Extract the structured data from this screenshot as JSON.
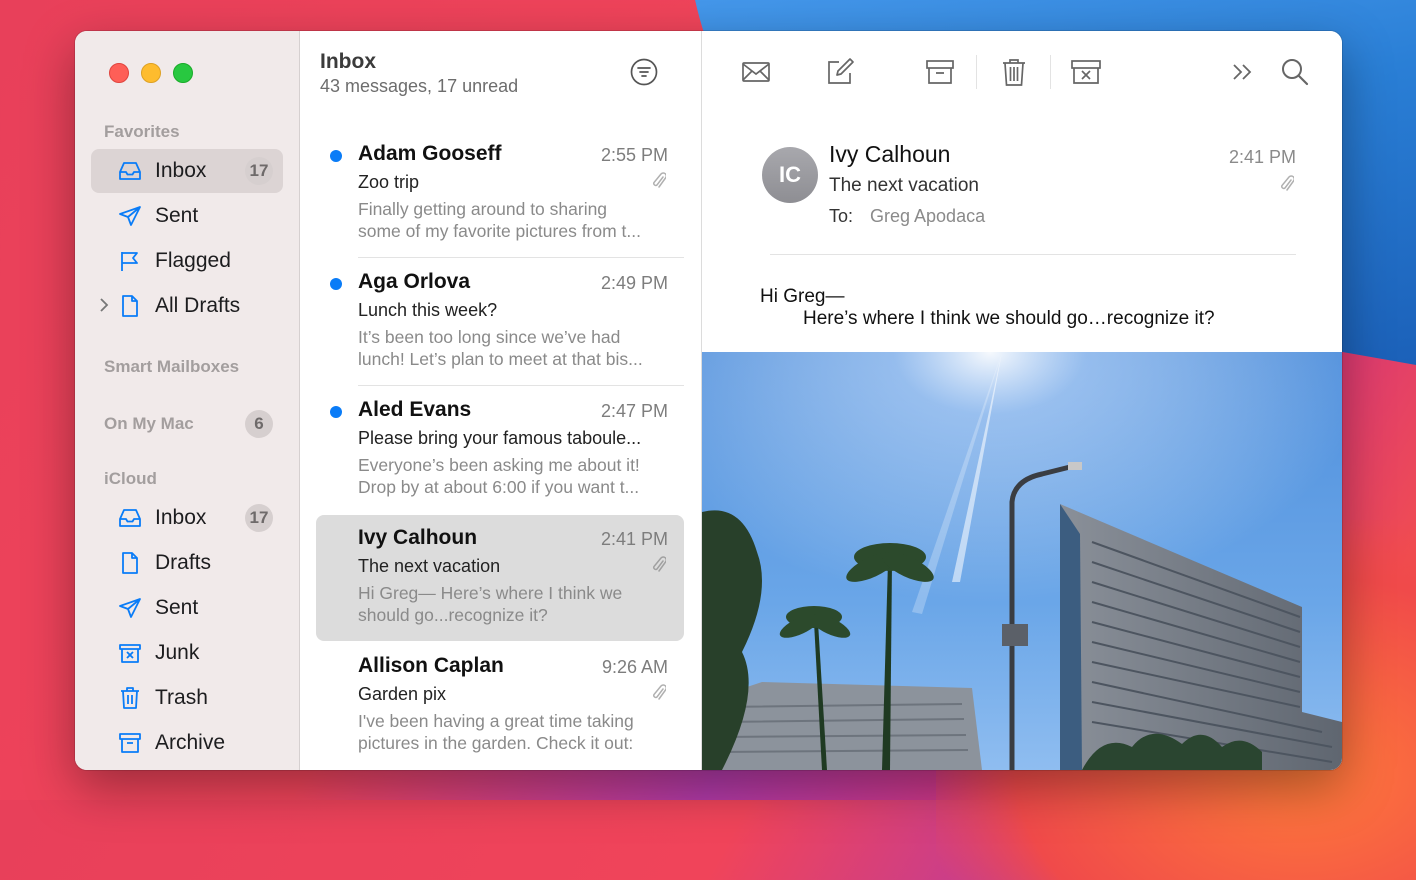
{
  "sidebar": {
    "favorites_header": "Favorites",
    "favorites": [
      {
        "label": "Inbox",
        "badge": "17",
        "icon": "inbox-icon",
        "selected": true
      },
      {
        "label": "Sent",
        "icon": "sent-icon"
      },
      {
        "label": "Flagged",
        "icon": "flag-icon"
      },
      {
        "label": "All Drafts",
        "icon": "drafts-icon",
        "expandable": true
      }
    ],
    "smart_mailboxes_header": "Smart Mailboxes",
    "on_my_mac_header": "On My Mac",
    "on_my_mac_badge": "6",
    "icloud_header": "iCloud",
    "icloud": [
      {
        "label": "Inbox",
        "badge": "17",
        "icon": "inbox-icon"
      },
      {
        "label": "Drafts",
        "icon": "drafts-icon"
      },
      {
        "label": "Sent",
        "icon": "sent-icon"
      },
      {
        "label": "Junk",
        "icon": "junk-icon"
      },
      {
        "label": "Trash",
        "icon": "trash-icon"
      },
      {
        "label": "Archive",
        "icon": "archive-icon"
      }
    ]
  },
  "list": {
    "title": "Inbox",
    "subtitle": "43 messages, 17 unread",
    "messages": [
      {
        "from": "Adam Gooseff",
        "time": "2:55 PM",
        "subject": "Zoo trip",
        "preview1": "Finally getting around to sharing",
        "preview2": "some of my favorite pictures from t...",
        "unread": true,
        "attachment": true
      },
      {
        "from": "Aga Orlova",
        "time": "2:49 PM",
        "subject": "Lunch this week?",
        "preview1": "It’s been too long since we’ve had",
        "preview2": "lunch! Let’s plan to meet at that bis...",
        "unread": true,
        "attachment": false
      },
      {
        "from": "Aled Evans",
        "time": "2:47 PM",
        "subject": "Please bring your famous taboule...",
        "preview1": "Everyone’s been asking me about it!",
        "preview2": "Drop by at about 6:00 if you want t...",
        "unread": true,
        "attachment": false
      },
      {
        "from": "Ivy Calhoun",
        "time": "2:41 PM",
        "subject": "The next vacation",
        "preview1": "Hi Greg— Here’s where I think we",
        "preview2": "should go...recognize it?",
        "unread": false,
        "attachment": true,
        "selected": true
      },
      {
        "from": "Allison Caplan",
        "time": "9:26 AM",
        "subject": "Garden pix",
        "preview1": "I've been having a great time taking",
        "preview2": "pictures in the garden. Check it out:",
        "unread": false,
        "attachment": true
      }
    ]
  },
  "reader": {
    "avatar_initials": "IC",
    "from": "Ivy Calhoun",
    "subject": "The next vacation",
    "to_label": "To:",
    "to": "Greg Apodaca",
    "time": "2:41 PM",
    "greeting": "Hi Greg—",
    "body": "Here’s where I think we should go…recognize it?"
  },
  "colors": {
    "accent": "#0a7cf7",
    "sidebar_bg": "#f1eaea",
    "selection": "#dcd4d4"
  }
}
